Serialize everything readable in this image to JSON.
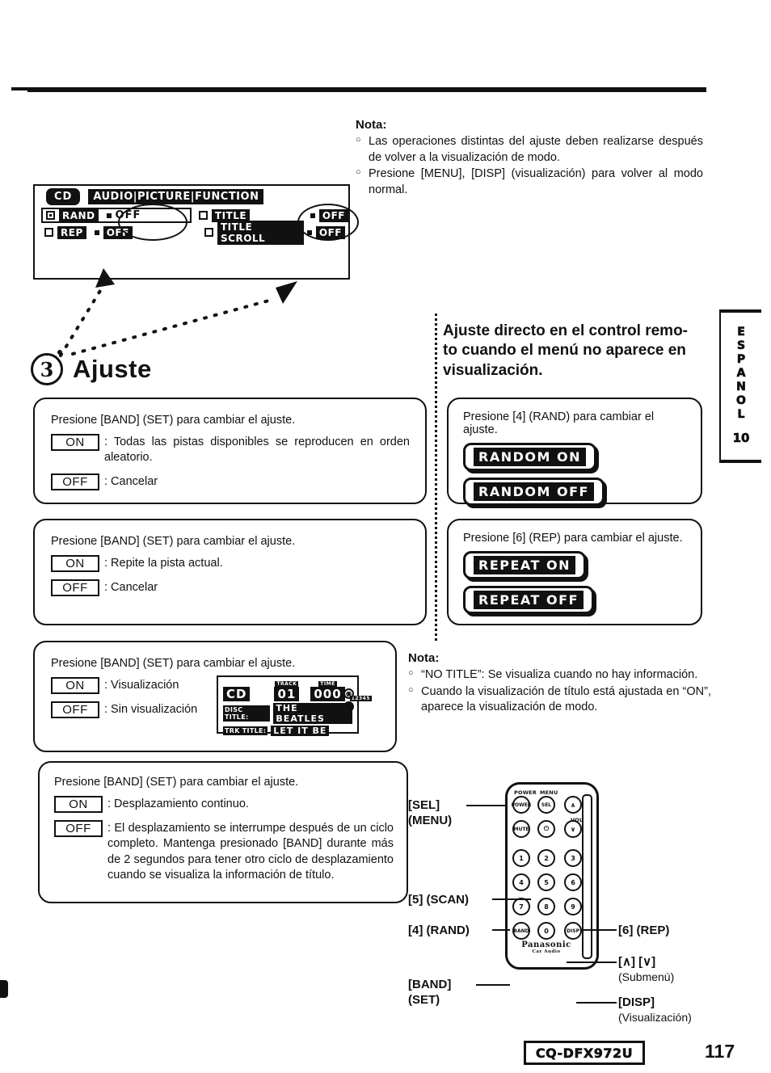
{
  "page": {
    "number": "117",
    "model": "CQ-DFX972U",
    "side_tab": {
      "language": "ESPANOL",
      "letters": [
        "E",
        "S",
        "P",
        "A",
        "N",
        "O",
        "L"
      ],
      "number": "10"
    }
  },
  "lcd_menu": {
    "cd_label": "CD",
    "tabs": "AUDIO|PICTURE|FUNCTION",
    "rows": [
      {
        "label": "RAND",
        "value": "OFF",
        "selected": true,
        "checked": true,
        "column": "left"
      },
      {
        "label": "REP",
        "value": "OFF",
        "selected": false,
        "checked": false,
        "column": "left"
      },
      {
        "label": "TITLE",
        "value": "OFF",
        "selected": false,
        "checked": false,
        "column": "right"
      },
      {
        "label": "TITLE SCROLL",
        "value": "OFF",
        "selected": false,
        "checked": false,
        "column": "right"
      }
    ]
  },
  "nota_top": {
    "title": "Nota:",
    "items": [
      "Las operaciones distintas del ajuste deben realizarse después de volver a la visualización de modo.",
      "Presione [MENU], [DISP] (visualización) para volver al modo normal."
    ]
  },
  "step": {
    "number": "3",
    "title": "Ajuste"
  },
  "right_heading": "Ajuste directo en el control remo-to cuando el menú no aparece en visualización.",
  "boxes": {
    "random": {
      "instruction": "Presione [BAND] (SET) para cambiar el ajuste.",
      "on_label": "ON",
      "on_text": ": Todas las pistas disponibles se reproducen en orden aleatorio.",
      "off_label": "OFF",
      "off_text": ": Cancelar"
    },
    "repeat": {
      "instruction": "Presione [BAND] (SET) para cambiar el ajuste.",
      "on_label": "ON",
      "on_text": ": Repite la pista actual.",
      "off_label": "OFF",
      "off_text": ": Cancelar"
    },
    "title": {
      "instruction": "Presione [BAND] (SET) para cambiar el ajuste.",
      "on_label": "ON",
      "on_text": ": Visualización",
      "off_label": "OFF",
      "off_text": ": Sin visualización"
    },
    "scroll": {
      "instruction": "Presione [BAND] (SET) para cambiar el ajuste.",
      "on_label": "ON",
      "on_text": ": Desplazamiento continuo.",
      "off_label": "OFF",
      "off_text": ": El desplazamiento se interrumpe después de un ciclo completo. Mantenga presionado [BAND] durante más de 2 segundos para tener otro ciclo de desplazamiento cuando se visualiza la información de título."
    },
    "remote_random": {
      "instruction": "Presione [4] (RAND) para cambiar el ajuste.",
      "display_on": "RANDOM ON",
      "display_off": "RANDOM OFF"
    },
    "remote_repeat": {
      "instruction": "Presione [6] (REP) para cambiar el ajuste.",
      "display_on": "REPEAT ON",
      "display_off": "REPEAT OFF"
    }
  },
  "cd_display": {
    "source": "CD",
    "track_caption": "TRACK",
    "track": "01",
    "time_caption": "TIME",
    "time": "000",
    "corner_caption": "12345",
    "disc_title_label": "DISC TITLE:",
    "disc_title_value": "THE BEATLES",
    "track_title_label": "TRK TITLE:",
    "track_title_value": "LET IT BE"
  },
  "nota_display": {
    "title": "Nota:",
    "items": [
      "“NO TITLE”: Se visualiza cuando no hay información.",
      "Cuando la visualización de título está ajustada en “ON”, aparece la visualización de modo."
    ]
  },
  "remote": {
    "brand": "Panasonic",
    "brand_sub": "Car Audio",
    "top_labels": {
      "power": "POWER",
      "menu": "MENU",
      "vol": "VOL"
    },
    "buttons": [
      {
        "name": "power",
        "label": "POWER"
      },
      {
        "name": "sel",
        "label": "SEL"
      },
      {
        "name": "mute",
        "label": "MUTE"
      },
      {
        "name": "source",
        "label": "⏻"
      },
      {
        "name": "vol-up",
        "label": "∧"
      },
      {
        "name": "vol-down",
        "label": "∨"
      },
      {
        "name": "1",
        "label": "1"
      },
      {
        "name": "2",
        "label": "2"
      },
      {
        "name": "3",
        "label": "3"
      },
      {
        "name": "4",
        "label": "4"
      },
      {
        "name": "5",
        "label": "5"
      },
      {
        "name": "6",
        "label": "6"
      },
      {
        "name": "7",
        "label": "7"
      },
      {
        "name": "8",
        "label": "8"
      },
      {
        "name": "9",
        "label": "9"
      },
      {
        "name": "band",
        "label": "BAND"
      },
      {
        "name": "0",
        "label": "0"
      },
      {
        "name": "disp",
        "label": "DISP"
      }
    ],
    "callouts": {
      "sel": "[SEL]",
      "sel_sub": "(MENU)",
      "scan": "[5] (SCAN)",
      "rand": "[4] (RAND)",
      "band": "[BAND]",
      "band_sub": "(SET)",
      "rep": "[6] (REP)",
      "updown": "[∧] [∨]",
      "updown_sub": "(Submenú)",
      "disp": "[DISP]",
      "disp_sub": "(Visualización)"
    }
  }
}
